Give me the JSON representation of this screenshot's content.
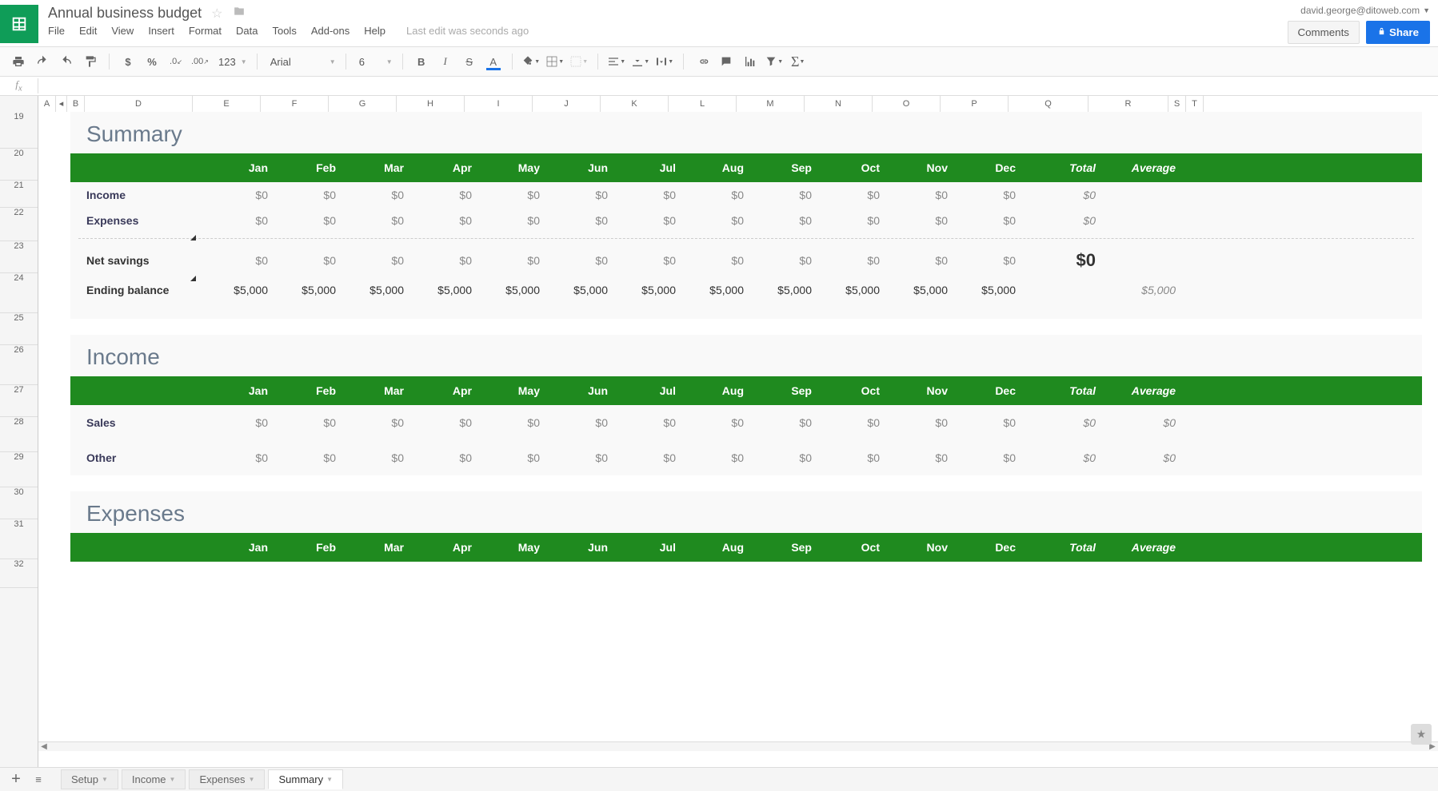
{
  "header": {
    "doc_title": "Annual business budget",
    "user_email": "david.george@ditoweb.com",
    "comments_label": "Comments",
    "share_label": "Share",
    "last_edit": "Last edit was seconds ago",
    "menus": [
      "File",
      "Edit",
      "View",
      "Insert",
      "Format",
      "Data",
      "Tools",
      "Add-ons",
      "Help"
    ]
  },
  "toolbar": {
    "font_name": "Arial",
    "font_size": "6",
    "number_format": "123"
  },
  "columns": [
    "A",
    "B",
    "D",
    "E",
    "F",
    "G",
    "H",
    "I",
    "J",
    "K",
    "L",
    "M",
    "N",
    "O",
    "P",
    "Q",
    "R",
    "S",
    "T"
  ],
  "col_group_indicator": "◂",
  "row_numbers": [
    "19",
    "20",
    "21",
    "22",
    "23",
    "24",
    "25",
    "26",
    "27",
    "28",
    "29",
    "30",
    "31",
    "32"
  ],
  "months": [
    "Jan",
    "Feb",
    "Mar",
    "Apr",
    "May",
    "Jun",
    "Jul",
    "Aug",
    "Sep",
    "Oct",
    "Nov",
    "Dec"
  ],
  "total_label": "Total",
  "average_label": "Average",
  "sections": {
    "summary": {
      "title": "Summary",
      "rows": [
        {
          "label": "Income",
          "vals": [
            "$0",
            "$0",
            "$0",
            "$0",
            "$0",
            "$0",
            "$0",
            "$0",
            "$0",
            "$0",
            "$0",
            "$0"
          ],
          "total": "$0",
          "avg": ""
        },
        {
          "label": "Expenses",
          "vals": [
            "$0",
            "$0",
            "$0",
            "$0",
            "$0",
            "$0",
            "$0",
            "$0",
            "$0",
            "$0",
            "$0",
            "$0"
          ],
          "total": "$0",
          "avg": ""
        }
      ],
      "net": {
        "label": "Net savings",
        "vals": [
          "$0",
          "$0",
          "$0",
          "$0",
          "$0",
          "$0",
          "$0",
          "$0",
          "$0",
          "$0",
          "$0",
          "$0"
        ],
        "total": "$0",
        "avg": ""
      },
      "ending": {
        "label": "Ending balance",
        "vals": [
          "$5,000",
          "$5,000",
          "$5,000",
          "$5,000",
          "$5,000",
          "$5,000",
          "$5,000",
          "$5,000",
          "$5,000",
          "$5,000",
          "$5,000",
          "$5,000"
        ],
        "total": "",
        "avg": "$5,000"
      }
    },
    "income": {
      "title": "Income",
      "rows": [
        {
          "label": "Sales",
          "vals": [
            "$0",
            "$0",
            "$0",
            "$0",
            "$0",
            "$0",
            "$0",
            "$0",
            "$0",
            "$0",
            "$0",
            "$0"
          ],
          "total": "$0",
          "avg": "$0"
        },
        {
          "label": "Other",
          "vals": [
            "$0",
            "$0",
            "$0",
            "$0",
            "$0",
            "$0",
            "$0",
            "$0",
            "$0",
            "$0",
            "$0",
            "$0"
          ],
          "total": "$0",
          "avg": "$0"
        }
      ]
    },
    "expenses": {
      "title": "Expenses"
    }
  },
  "tabs": [
    "Setup",
    "Income",
    "Expenses",
    "Summary"
  ],
  "active_tab": "Summary"
}
